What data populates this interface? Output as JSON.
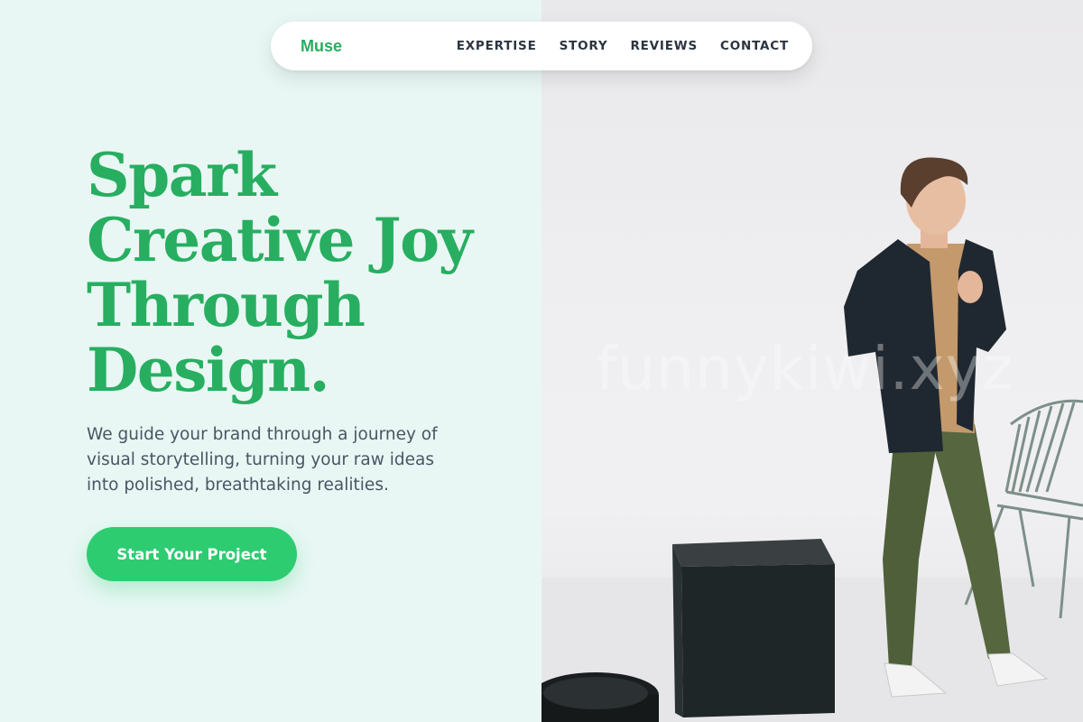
{
  "nav": {
    "brand": "Muse",
    "links": [
      {
        "label": "EXPERTISE"
      },
      {
        "label": "STORY"
      },
      {
        "label": "REVIEWS"
      },
      {
        "label": "CONTACT"
      }
    ]
  },
  "hero": {
    "headline_lines": [
      "Spark",
      "Creative Joy",
      "Through",
      "Design."
    ],
    "subcopy": "We guide your brand through a journey of visual storytelling, turning your raw ideas into polished, breathtaking realities.",
    "cta_label": "Start Your Project"
  },
  "watermark": "funnykiwi.xyz",
  "colors": {
    "accent": "#27ae60",
    "button": "#2ecc71",
    "left_background": "#e8f7f4",
    "nav_text": "#2c3440",
    "body_text": "#4a5563"
  }
}
